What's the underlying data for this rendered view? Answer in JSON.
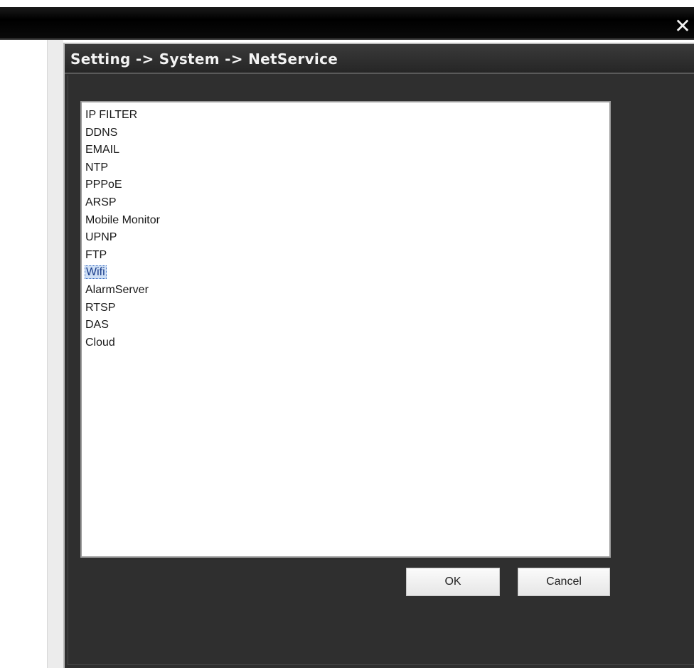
{
  "window": {
    "close_glyph": "✕"
  },
  "dialog": {
    "title": "Setting -> System -> NetService"
  },
  "services": {
    "items": [
      {
        "label": "IP FILTER",
        "selected": false
      },
      {
        "label": "DDNS",
        "selected": false
      },
      {
        "label": "EMAIL",
        "selected": false
      },
      {
        "label": "NTP",
        "selected": false
      },
      {
        "label": "PPPoE",
        "selected": false
      },
      {
        "label": "ARSP",
        "selected": false
      },
      {
        "label": "Mobile Monitor",
        "selected": false
      },
      {
        "label": "UPNP",
        "selected": false
      },
      {
        "label": "FTP",
        "selected": false
      },
      {
        "label": "Wifi",
        "selected": true
      },
      {
        "label": "AlarmServer",
        "selected": false
      },
      {
        "label": "RTSP",
        "selected": false
      },
      {
        "label": "DAS",
        "selected": false
      },
      {
        "label": "Cloud",
        "selected": false
      }
    ]
  },
  "buttons": {
    "ok_label": "OK",
    "cancel_label": "Cancel"
  },
  "colors": {
    "dialog_bg": "#2f2f2f",
    "titlebar_bg": "#000000",
    "selection_bg": "#cfe0f6"
  }
}
